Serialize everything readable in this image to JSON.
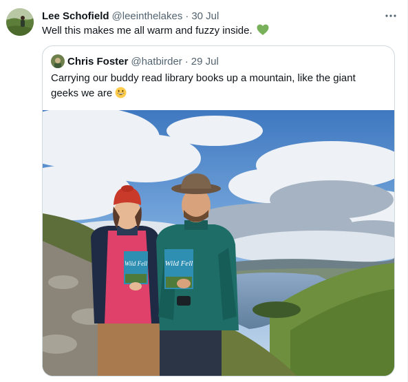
{
  "tweet": {
    "author_name": "Lee Schofield",
    "author_handle": "@leeinthelakes",
    "separator": "·",
    "date": "30 Jul",
    "text": "Well this makes me all warm and fuzzy inside.",
    "emoji": "green-heart-icon"
  },
  "quoted_tweet": {
    "author_name": "Chris Foster",
    "author_handle": "@hatbirder",
    "separator": "·",
    "date": "29 Jul",
    "text": "Carrying our buddy read library books up a mountain, like the giant geeks we are",
    "emoji": "grinning-face-icon",
    "photo_book_title": "Wild Fell"
  },
  "colors": {
    "text_primary": "#0f1419",
    "text_secondary": "#536471",
    "border": "#cfd9de",
    "heart": "#78b159"
  }
}
